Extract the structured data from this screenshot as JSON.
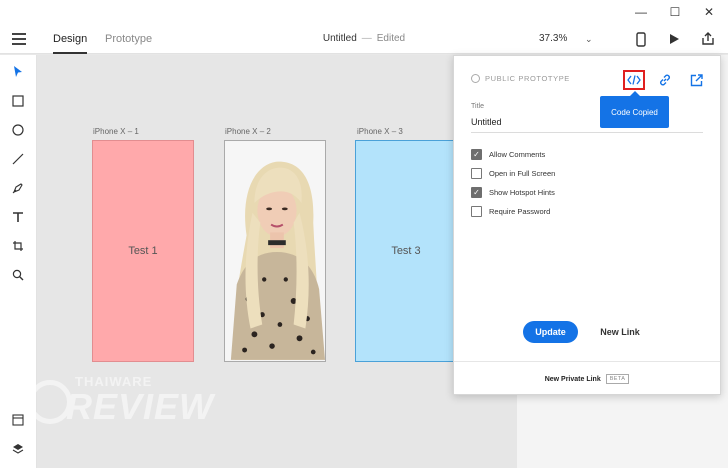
{
  "titlebar": {
    "minimize": "—",
    "maximize": "☐",
    "close": "✕"
  },
  "toolbar": {
    "tabs": [
      {
        "label": "Design"
      },
      {
        "label": "Prototype"
      }
    ],
    "doc_title": "Untitled",
    "doc_separator": "—",
    "doc_state": "Edited",
    "zoom": "37.3%"
  },
  "canvas": {
    "artboards": [
      {
        "label": "iPhone X – 1",
        "text": "Test 1",
        "color": "#ffa9ab"
      },
      {
        "label": "iPhone X – 2",
        "text": "",
        "color": "#f5f5f5"
      },
      {
        "label": "iPhone X – 3",
        "text": "Test 3",
        "color": "#b3e3fb"
      }
    ]
  },
  "share_panel": {
    "header": "PUBLIC PROTOTYPE",
    "tooltip": "Code Copied",
    "title_label": "Title",
    "title_value": "Untitled",
    "options": [
      {
        "label": "Allow Comments",
        "checked": true
      },
      {
        "label": "Open in Full Screen",
        "checked": false
      },
      {
        "label": "Show Hotspot Hints",
        "checked": true
      },
      {
        "label": "Require Password",
        "checked": false
      }
    ],
    "update_label": "Update",
    "new_link_label": "New Link",
    "private_link_label": "New Private Link",
    "beta_label": "BETA",
    "accent_color": "#1473e6"
  },
  "watermark": {
    "small": "THAIWARE",
    "big": "REVIEW"
  }
}
